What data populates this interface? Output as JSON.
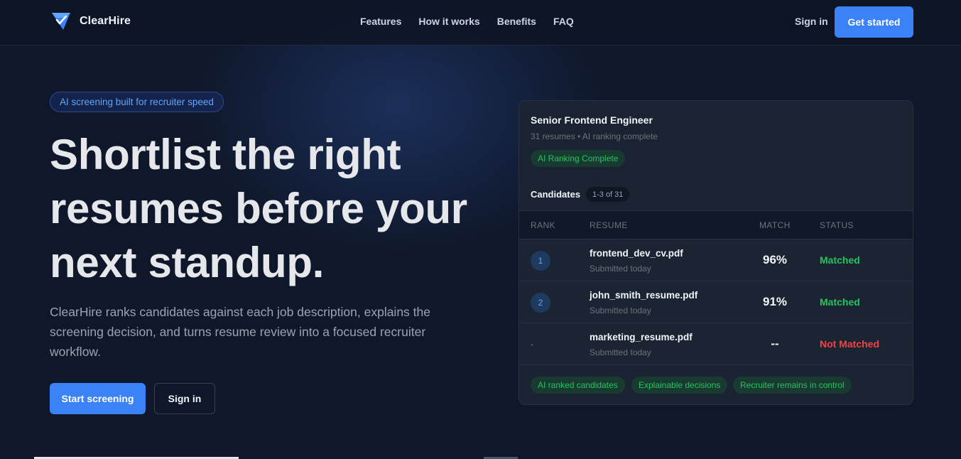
{
  "nav": {
    "brand": "ClearHire",
    "links": [
      "Features",
      "How it works",
      "Benefits",
      "FAQ"
    ],
    "sign_in": "Sign in",
    "get_started": "Get started"
  },
  "hero": {
    "badge": "AI screening built for recruiter speed",
    "headline_lines": [
      "Shortlist the right",
      "resumes before your",
      "next standup."
    ],
    "subtext": "ClearHire ranks candidates against each job description, explains the screening decision, and turns resume review into a focused recruiter workflow.",
    "start_screening": "Start screening",
    "sign_in": "Sign in"
  },
  "card": {
    "job_title": "Senior Frontend Engineer",
    "job_meta": "31 resumes • AI ranking complete",
    "status_badge": "AI Ranking Complete",
    "candidates_label": "Candidates",
    "count": "1-3 of 31",
    "columns": [
      "RANK",
      "RESUME",
      "MATCH",
      "STATUS"
    ],
    "rows": [
      {
        "rank": "1",
        "file": "frontend_dev_cv.pdf",
        "submitted": "Submitted today",
        "match": "96%",
        "status": "Matched"
      },
      {
        "rank": "2",
        "file": "john_smith_resume.pdf",
        "submitted": "Submitted today",
        "match": "91%",
        "status": "Matched"
      },
      {
        "rank": "-",
        "file": "marketing_resume.pdf",
        "submitted": "Submitted today",
        "match": "--",
        "status": "Not Matched"
      }
    ],
    "tags": [
      "AI ranked candidates",
      "Explainable decisions",
      "Recruiter remains in control"
    ]
  },
  "colors": {
    "accent": "#3b82f6",
    "matched": "#22c55e",
    "not_matched": "#ef4444",
    "background": "#0f172a"
  }
}
